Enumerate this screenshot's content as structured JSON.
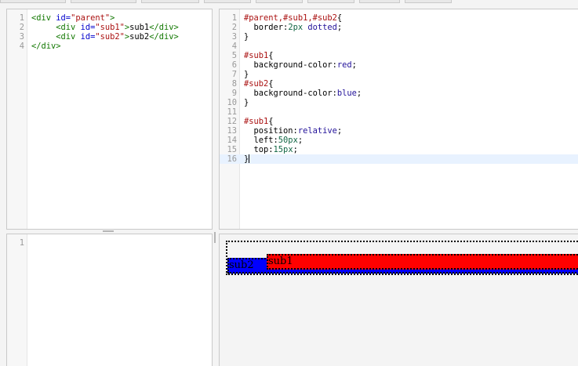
{
  "html_editor": {
    "lines": [
      {
        "num": "1",
        "parts": [
          {
            "c": "tag",
            "t": "<div "
          },
          {
            "c": "attr",
            "t": "id="
          },
          {
            "c": "str",
            "t": "\"parent\""
          },
          {
            "c": "tag",
            "t": ">"
          }
        ]
      },
      {
        "num": "2",
        "parts": [
          {
            "c": "tag",
            "t": "     <div "
          },
          {
            "c": "attr",
            "t": "id="
          },
          {
            "c": "str",
            "t": "\"sub1\""
          },
          {
            "c": "tag",
            "t": ">"
          },
          {
            "c": "prop",
            "t": "sub1"
          },
          {
            "c": "tag",
            "t": "</div>"
          }
        ]
      },
      {
        "num": "3",
        "parts": [
          {
            "c": "tag",
            "t": "     <div "
          },
          {
            "c": "attr",
            "t": "id="
          },
          {
            "c": "str",
            "t": "\"sub2\""
          },
          {
            "c": "tag",
            "t": ">"
          },
          {
            "c": "prop",
            "t": "sub2"
          },
          {
            "c": "tag",
            "t": "</div>"
          }
        ]
      },
      {
        "num": "4",
        "parts": [
          {
            "c": "tag",
            "t": "</div>"
          }
        ]
      }
    ]
  },
  "css_editor": {
    "lines": [
      {
        "num": "1",
        "parts": [
          {
            "c": "sel",
            "t": "#parent,#sub1,#sub2"
          },
          {
            "c": "prop",
            "t": "{"
          }
        ]
      },
      {
        "num": "2",
        "parts": [
          {
            "c": "prop",
            "t": "  border:"
          },
          {
            "c": "num",
            "t": "2px"
          },
          {
            "c": "kw",
            "t": " dotted"
          },
          {
            "c": "prop",
            "t": ";"
          }
        ]
      },
      {
        "num": "3",
        "parts": [
          {
            "c": "prop",
            "t": "}"
          }
        ]
      },
      {
        "num": "4",
        "parts": []
      },
      {
        "num": "5",
        "parts": [
          {
            "c": "sel",
            "t": "#sub1"
          },
          {
            "c": "prop",
            "t": "{"
          }
        ]
      },
      {
        "num": "6",
        "parts": [
          {
            "c": "prop",
            "t": "  background-color:"
          },
          {
            "c": "kw",
            "t": "red"
          },
          {
            "c": "prop",
            "t": ";"
          }
        ]
      },
      {
        "num": "7",
        "parts": [
          {
            "c": "prop",
            "t": "}"
          }
        ]
      },
      {
        "num": "8",
        "parts": [
          {
            "c": "sel",
            "t": "#sub2"
          },
          {
            "c": "prop",
            "t": "{"
          }
        ]
      },
      {
        "num": "9",
        "parts": [
          {
            "c": "prop",
            "t": "  background-color:"
          },
          {
            "c": "kw",
            "t": "blue"
          },
          {
            "c": "prop",
            "t": ";"
          }
        ]
      },
      {
        "num": "10",
        "parts": [
          {
            "c": "prop",
            "t": "}"
          }
        ]
      },
      {
        "num": "11",
        "parts": []
      },
      {
        "num": "12",
        "parts": [
          {
            "c": "sel",
            "t": "#sub1"
          },
          {
            "c": "prop",
            "t": "{"
          }
        ]
      },
      {
        "num": "13",
        "parts": [
          {
            "c": "prop",
            "t": "  position:"
          },
          {
            "c": "kw",
            "t": "relative"
          },
          {
            "c": "prop",
            "t": ";"
          }
        ]
      },
      {
        "num": "14",
        "parts": [
          {
            "c": "prop",
            "t": "  left:"
          },
          {
            "c": "num",
            "t": "50px"
          },
          {
            "c": "prop",
            "t": ";"
          }
        ]
      },
      {
        "num": "15",
        "parts": [
          {
            "c": "prop",
            "t": "  top:"
          },
          {
            "c": "num",
            "t": "15px"
          },
          {
            "c": "prop",
            "t": ";"
          }
        ]
      },
      {
        "num": "16",
        "parts": [
          {
            "c": "prop",
            "t": "}"
          }
        ],
        "active": true
      }
    ]
  },
  "js_editor": {
    "lines": [
      {
        "num": "1",
        "parts": []
      }
    ]
  },
  "result": {
    "sub1_text": "sub1",
    "sub2_text": "sub2"
  }
}
